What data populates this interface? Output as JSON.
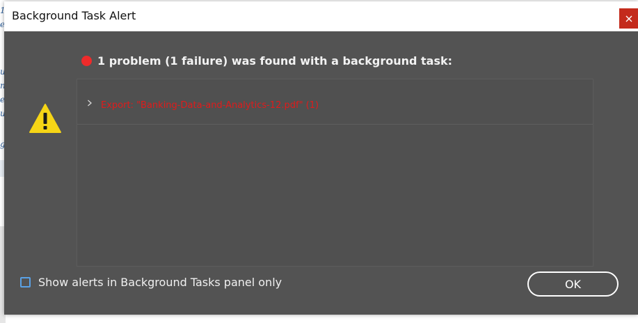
{
  "dialog": {
    "title": "Background Task Alert",
    "headline": "1 problem (1 failure) was found with a background task:",
    "problems": [
      {
        "label": "Export: \"Banking-Data-and-Analytics-12.pdf\" (1)",
        "expanded": false
      }
    ],
    "show_alerts_label": "Show alerts in Background Tasks panel only",
    "show_alerts_checked": false,
    "ok_label": "OK"
  },
  "icons": {
    "close": "close-icon",
    "warning": "warning-triangle-icon",
    "error": "error-dot-icon",
    "expand": "chevron-right-icon"
  },
  "colors": {
    "dialog_bg": "#535353",
    "titlebar_bg": "#ffffff",
    "close_bg": "#c42b1c",
    "error_red": "#e01b1b",
    "error_dot": "#ef2b2b",
    "warning_yellow": "#f6d516",
    "checkbox_border": "#5aa2e6"
  }
}
